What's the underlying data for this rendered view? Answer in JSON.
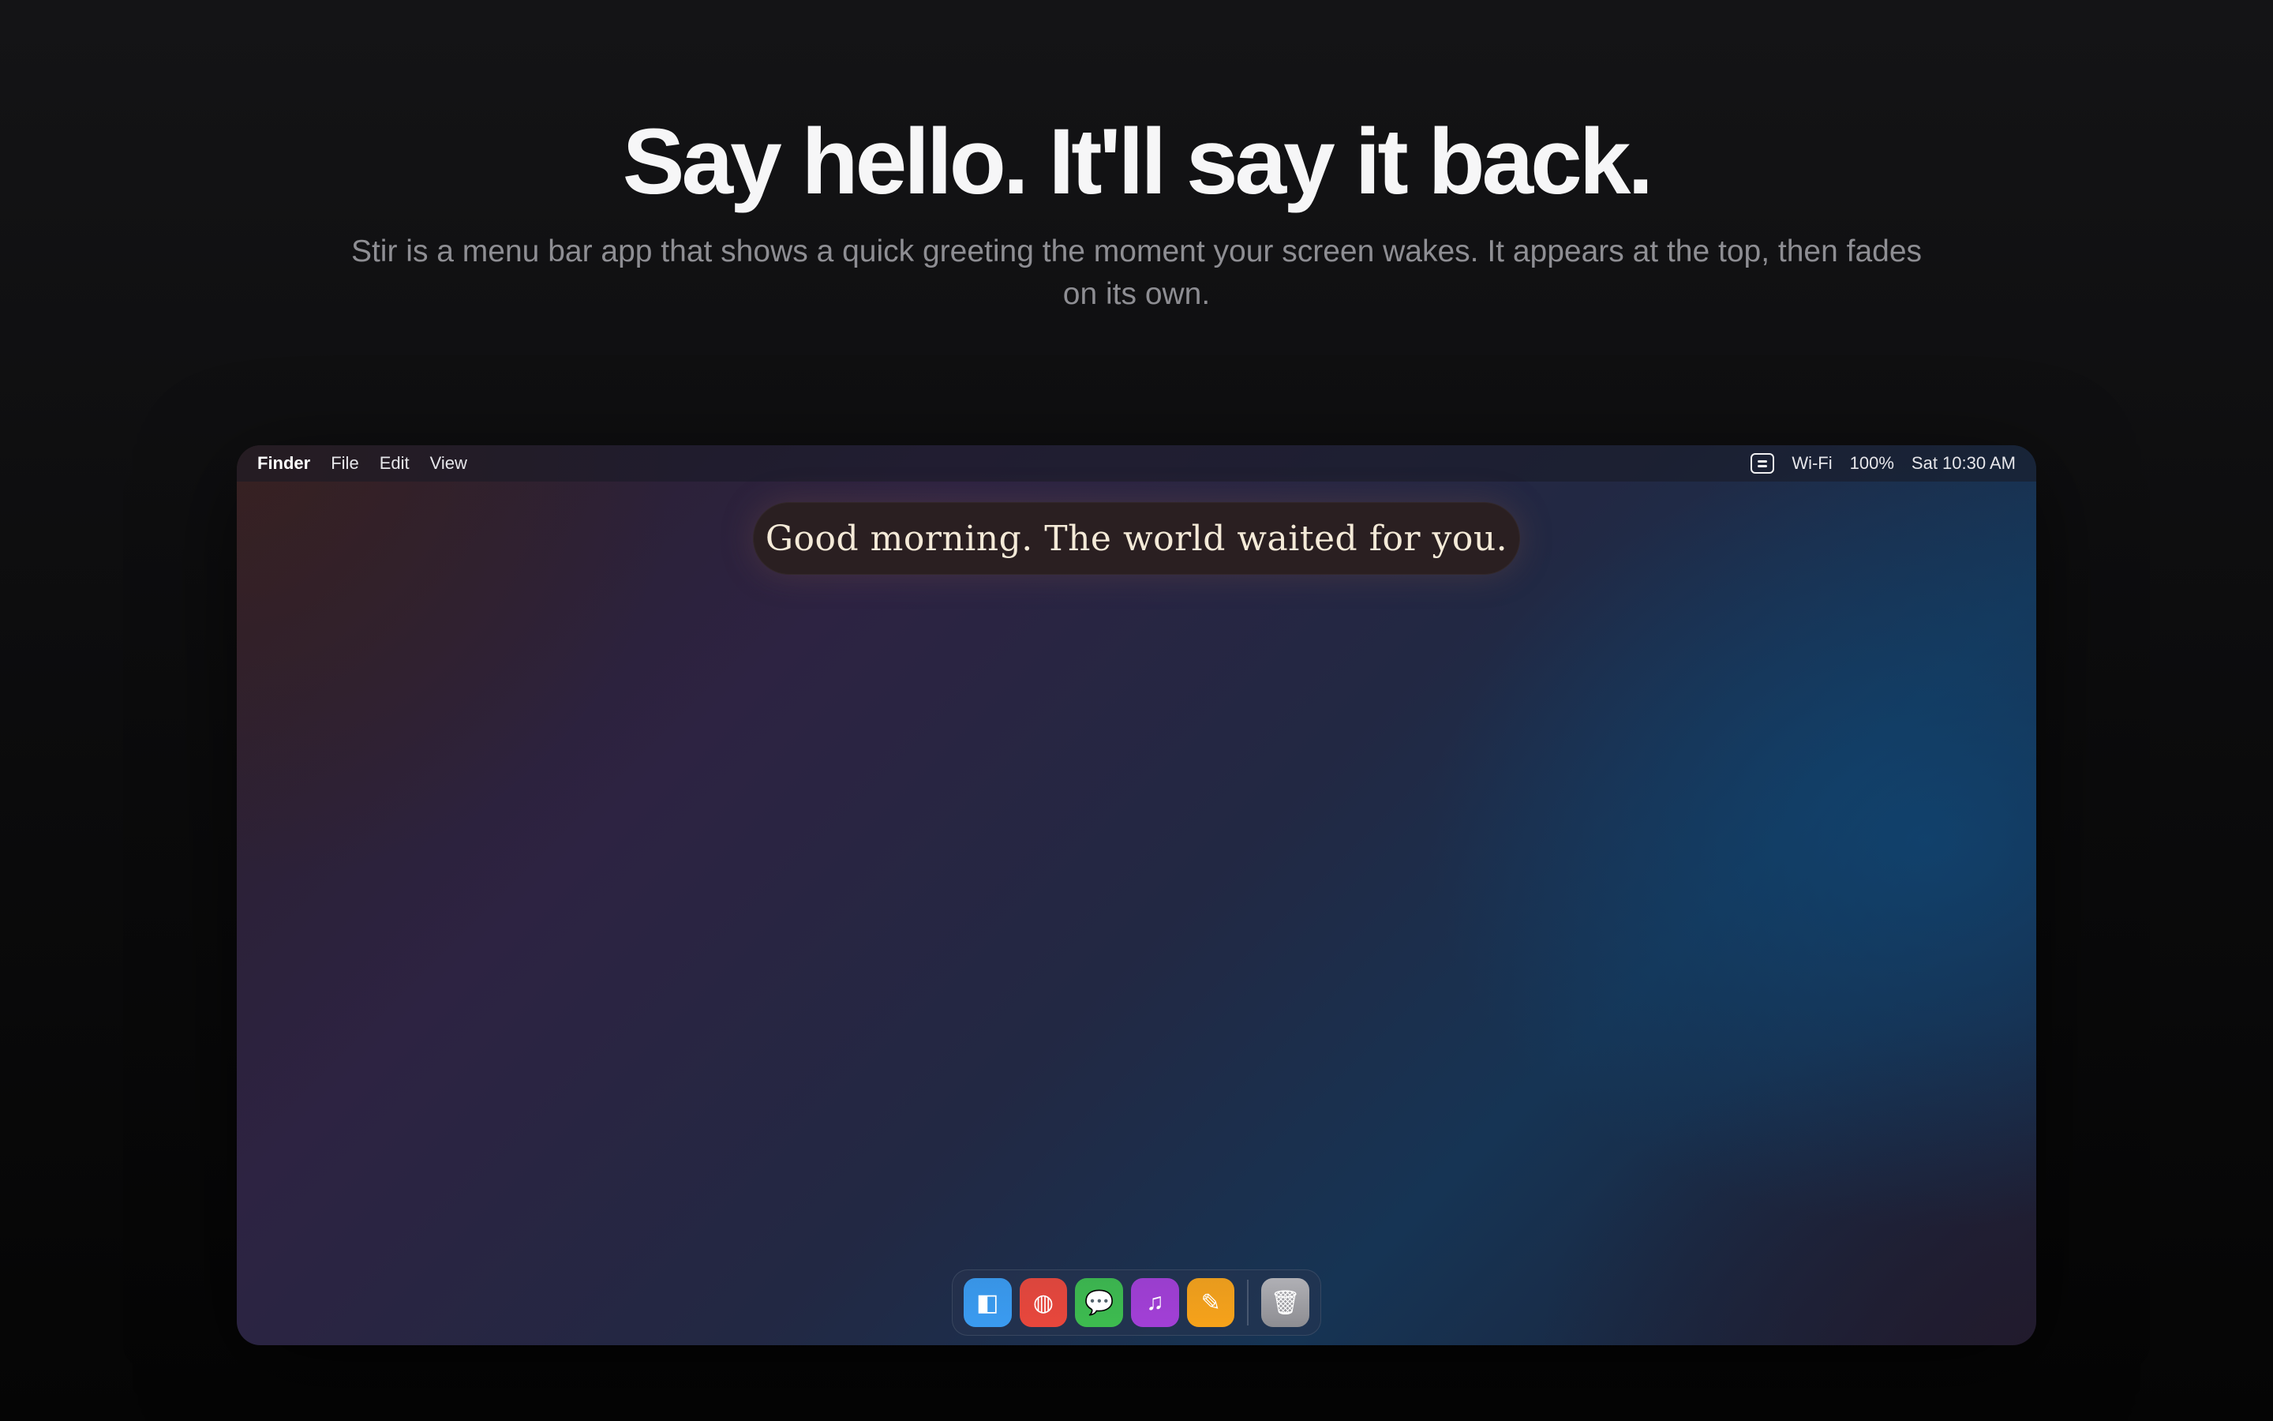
{
  "hero": {
    "title": "Say hello. It'll say it back.",
    "subtitle": "Stir is a menu bar app that shows a quick greeting the moment your screen wakes. It appears at the top, then fades on its own."
  },
  "menubar": {
    "app_name": "Finder",
    "items": [
      "File",
      "Edit",
      "View"
    ],
    "status": {
      "wifi": "Wi-Fi",
      "battery": "100%",
      "clock": "Sat 10:30 AM"
    }
  },
  "greeting": {
    "text": "Good morning. The world waited for you."
  },
  "dock": {
    "apps": [
      {
        "icon": "finder-icon",
        "glyph": "◧",
        "color": "#3a9bf0"
      },
      {
        "icon": "browser-icon",
        "glyph": "◍",
        "color": "#e8473c"
      },
      {
        "icon": "messages-icon",
        "glyph": "💬",
        "color": "#3dbb4f"
      },
      {
        "icon": "music-icon",
        "glyph": "♫",
        "color": "#a23fd6"
      },
      {
        "icon": "notes-icon",
        "glyph": "✎",
        "color": "#f6a21a"
      }
    ],
    "trash": {
      "icon": "trash-icon",
      "glyph": "🗑",
      "color": "#8d8d92"
    }
  },
  "colors": {
    "page_bg": "#111113",
    "greeting_bg": "#2a1f21",
    "greeting_text": "#f4ead8",
    "subtitle_text": "#8e8e93"
  }
}
